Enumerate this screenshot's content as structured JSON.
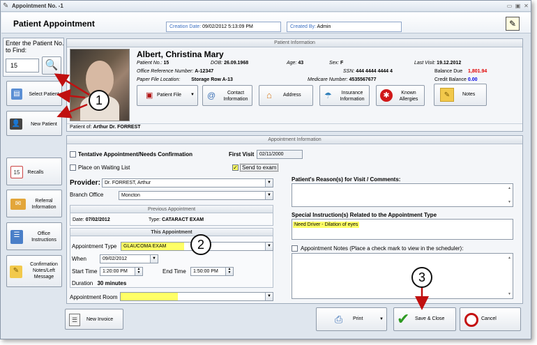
{
  "window": {
    "title": "Appointment No. -1",
    "minimize_glyph": "▭",
    "maximize_glyph": "▣",
    "close_glyph": "✕"
  },
  "header": {
    "page_title": "Patient Appointment",
    "creation_date_label": "Creation Date:",
    "creation_date_value": "09/02/2012 5:13:09 PM",
    "created_by_label": "Created By:",
    "created_by_value": "Admin"
  },
  "finder": {
    "label": "Enter the Patient No. to Find:",
    "value": "15"
  },
  "sidebar": {
    "select_patient": "Select Patient",
    "new_patient": "New Patient",
    "recalls": "Recalls",
    "referral": "Referral Information",
    "office": "Office Instructions",
    "confirmation": "Confirmation Notes/Left Message",
    "recalls_icon_text": "15"
  },
  "patient_info": {
    "section_title": "Patient Information",
    "name": "Albert, Christina Mary",
    "patient_no_label": "Patient No.:",
    "patient_no": "15",
    "dob_label": "DOB:",
    "dob": "26.09.1968",
    "age_label": "Age:",
    "age": "43",
    "sex_label": "Sex:",
    "sex": "F",
    "last_visit_label": "Last Visit:",
    "last_visit": "19.12.2012",
    "office_ref_label": "Office Reference Number:",
    "office_ref": "A-12347",
    "ssn_label": "SSN:",
    "ssn": "444 4444 4444 4",
    "balance_due_label": "Balance Due",
    "balance_due": "1,801.94",
    "paper_file_label": "Paper File Location:",
    "paper_file": "Storage Row A-13",
    "medicare_label": "Medicare Number:",
    "medicare": "4535567677",
    "credit_balance_label": "Credit Balance",
    "credit_balance": "0.00",
    "patient_of_label": "Patient of:",
    "patient_of": "Arthur Dr. FORREST",
    "buttons": {
      "patient_file": "Patient File",
      "contact": "Contact Information",
      "address": "Address",
      "insurance": "Insurance Information",
      "allergies": "Known Allergies",
      "notes": "Notes"
    }
  },
  "appointment": {
    "section_title": "Appointment Information",
    "tentative_label": "Tentative Appointment/Needs Confirmation",
    "first_visit_label": "First Visit",
    "first_visit": "02/11/2000",
    "waiting_list_label": "Place on Waiting List",
    "send_to_exam_label": "Send to exam",
    "send_to_exam_check": "✓",
    "provider_label": "Provider:",
    "provider": "Dr. FORREST, Arthur",
    "branch_label": "Branch Office",
    "branch": "Moncton",
    "previous_title": "Previous Appointment",
    "prev_date_label": "Date:",
    "prev_date": "07/02/2012",
    "prev_type_label": "Type:",
    "prev_type": "CATARACT EXAM",
    "this_title": "This Appointment",
    "type_label": "Appointment Type",
    "type": "GLAUCOMA EXAM",
    "when_label": "When",
    "when": "09/02/2012",
    "start_label": "Start Time",
    "start": "1:20:00 PM",
    "end_label": "End Time",
    "end": "1:50:00 PM",
    "duration_label": "Duration",
    "duration": "30 minutes",
    "room_label": "Appointment Room",
    "room": "",
    "reason_label": "Patient's Reason(s) for Visit / Comments:",
    "special_label": "Special Instruction(s) Related to the Appointment Type",
    "special_value": "Need Driver - Dilation of eyes",
    "notes_label": "Appointment Notes (Place a check mark to view in the scheduler):"
  },
  "footer": {
    "new_invoice": "New Invoice",
    "print": "Print",
    "save_close": "Save & Close",
    "cancel": "Cancel"
  },
  "callouts": [
    "1",
    "2",
    "3"
  ],
  "colors": {
    "arrow_red": "#c01010",
    "highlight_yellow": "#ffff66",
    "balance_red": "#e00000",
    "credit_blue": "#0000e0"
  }
}
